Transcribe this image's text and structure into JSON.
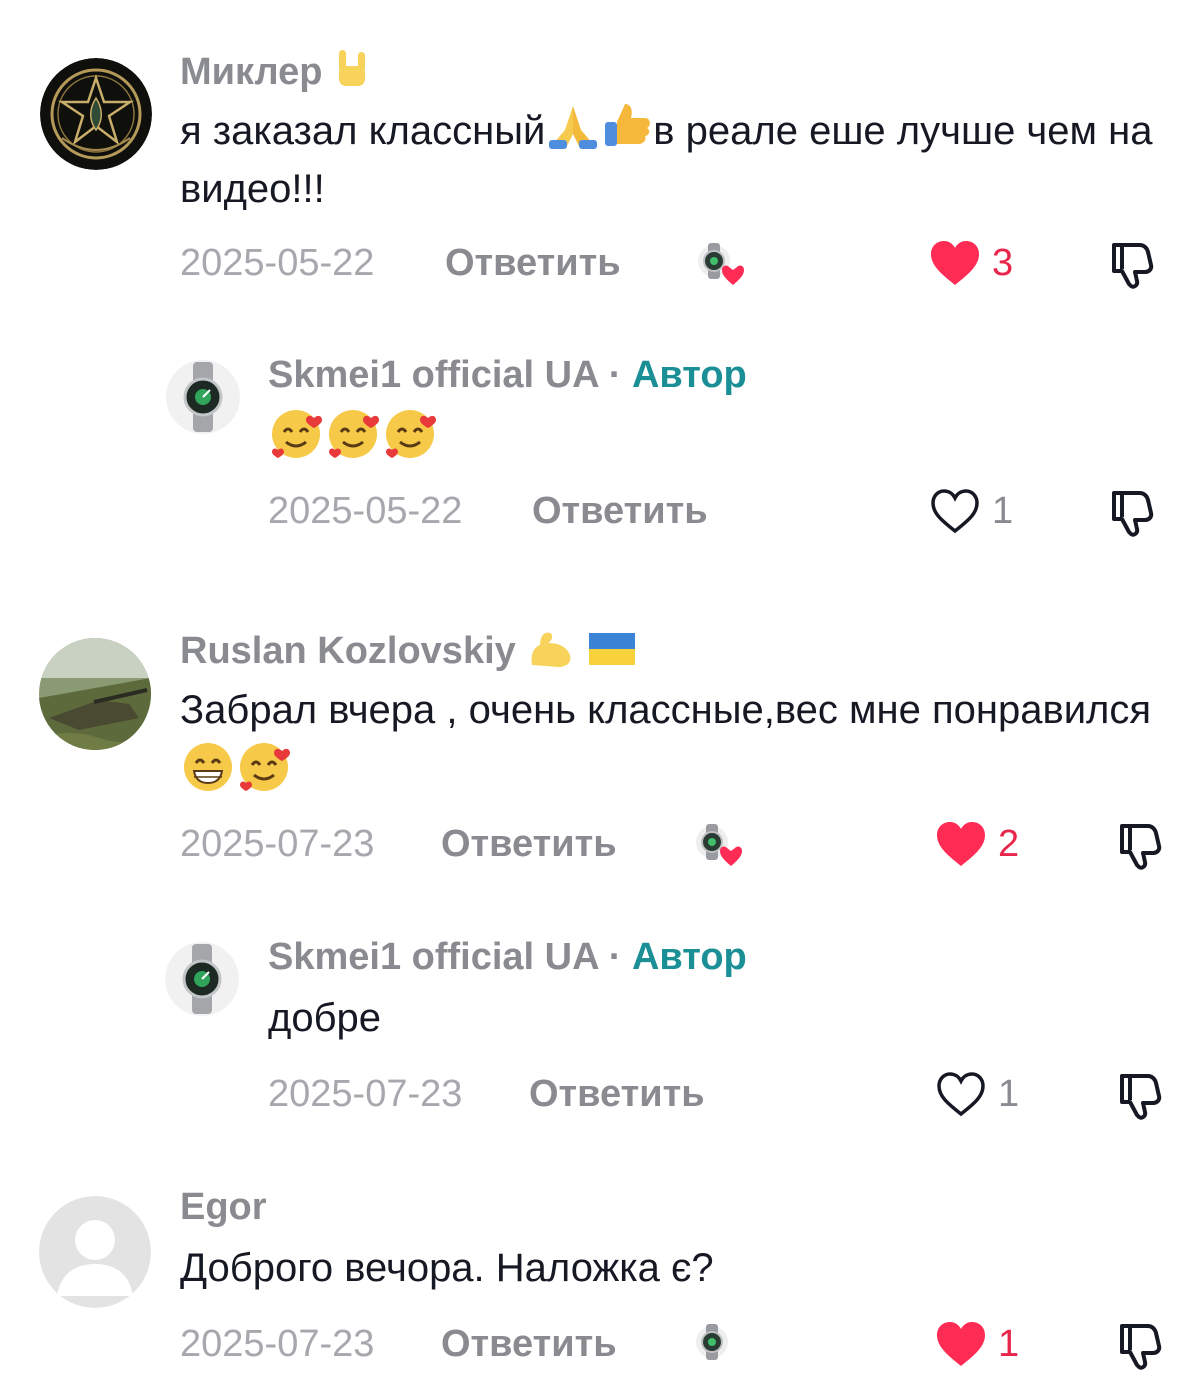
{
  "comments": [
    {
      "username": "Миклер",
      "username_emoji": "rock-hand-emoji",
      "text_part1": "я заказал классный",
      "text_part2": "в реале еше лучше чем на видео!!!",
      "text_emojis": [
        "folded-hands-emoji",
        "thumbs-up-emoji"
      ],
      "date": "2025-05-22",
      "reply_label": "Ответить",
      "creator_liked": true,
      "likes": "3",
      "liked": true,
      "reply": {
        "username": "Skmei1 official UA",
        "separator": "·",
        "author_tag": "Автор",
        "text": "",
        "text_emojis": [
          "smiling-face-with-hearts-emoji",
          "smiling-face-with-hearts-emoji",
          "smiling-face-with-hearts-emoji"
        ],
        "date": "2025-05-22",
        "reply_label": "Ответить",
        "likes": "1",
        "liked": false
      }
    },
    {
      "username": "Ruslan Kozlovskiy",
      "username_emojis": [
        "flexed-biceps-emoji",
        "ukraine-flag-emoji"
      ],
      "text_part1": "Забрал вчера , очень классные,вес мне понравился",
      "text_emojis": [
        "grinning-face-emoji",
        "smiling-face-with-hearts-emoji"
      ],
      "date": "2025-07-23",
      "reply_label": "Ответить",
      "creator_liked": true,
      "likes": "2",
      "liked": true,
      "reply": {
        "username": "Skmei1 official UA",
        "separator": "·",
        "author_tag": "Автор",
        "text": "добре",
        "date": "2025-07-23",
        "reply_label": "Ответить",
        "likes": "1",
        "liked": false
      }
    },
    {
      "username": "Egor",
      "text_part1": "Доброго вечора. Наложка є?",
      "date": "2025-07-23",
      "reply_label": "Ответить",
      "creator_liked": true,
      "likes": "1",
      "liked": true
    }
  ],
  "colors": {
    "like_red": "#fe2c55",
    "author_teal": "#1b8f96",
    "secondary_grey": "#8a8b91",
    "date_grey": "#a7a8ad",
    "text_dark": "#161823"
  }
}
